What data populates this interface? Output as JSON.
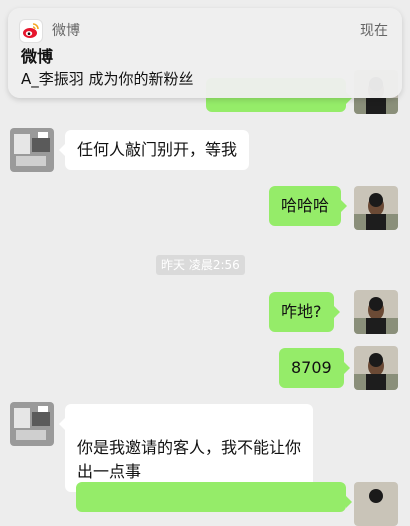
{
  "notification": {
    "app_name": "微博",
    "app_icon": "weibo-icon",
    "time": "现在",
    "title": "微博",
    "body": "A_李振羽 成为你的新粉丝"
  },
  "messages": [
    {
      "side": "out",
      "text": ""
    },
    {
      "side": "in",
      "text": "任何人敲门别开，等我"
    },
    {
      "side": "out",
      "text": "哈哈哈"
    },
    {
      "side": "out",
      "text": "咋地?"
    },
    {
      "side": "out",
      "text": "8709"
    },
    {
      "side": "in",
      "text": "你是我邀请的客人，我不能让你\n出一点事"
    },
    {
      "side": "out",
      "text": ""
    }
  ],
  "timestamp": "昨天 凌晨2:56",
  "colors": {
    "background": "#ededed",
    "outgoing_bubble": "#95ec69",
    "incoming_bubble": "#ffffff",
    "timestamp_bg": "#dadada",
    "weibo_red": "#e6162d",
    "weibo_orange": "#f5a623"
  }
}
